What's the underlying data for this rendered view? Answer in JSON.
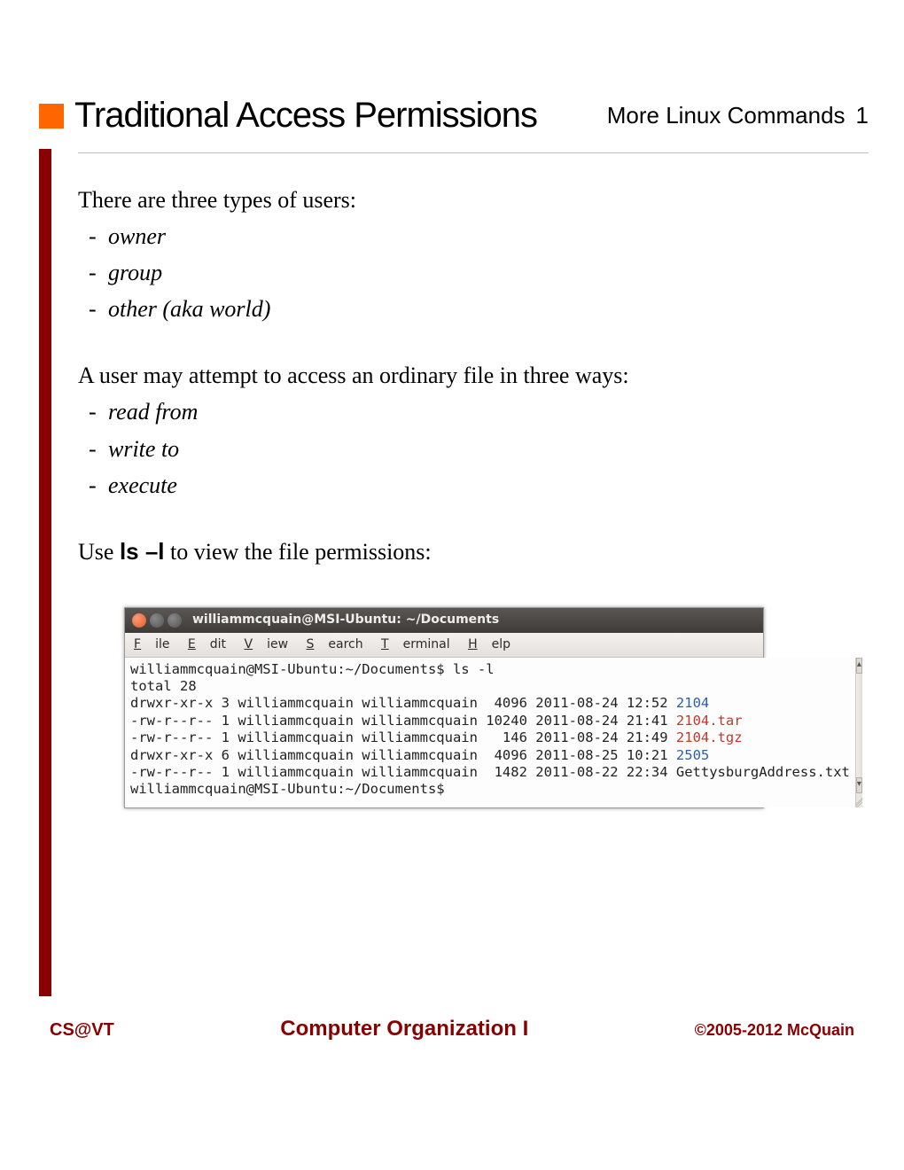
{
  "header": {
    "title": "Traditional Access Permissions",
    "section": "More Linux Commands",
    "page": "1"
  },
  "body": {
    "users_intro": "There are three types of users:",
    "users": [
      "owner",
      "group",
      "other (aka world)"
    ],
    "access_intro": "A user may attempt to access an ordinary file in three ways:",
    "access": [
      "read from",
      "write to",
      "execute"
    ],
    "ls_pre": "Use ",
    "ls_cmd": "ls –l",
    "ls_post": " to view the file permissions:"
  },
  "terminal": {
    "window_title": "williammcquain@MSI-Ubuntu: ~/Documents",
    "menu": {
      "file": "File",
      "edit": "Edit",
      "view": "View",
      "search": "Search",
      "terminal": "Terminal",
      "help": "Help"
    },
    "lines": {
      "prompt_cmd": "williammcquain@MSI-Ubuntu:~/Documents$ ls -l",
      "total": "total 28",
      "r1a": "drwxr-xr-x 3 williammcquain williammcquain  4096 2011-08-24 12:52 ",
      "r1b": "2104",
      "r2a": "-rw-r--r-- 1 williammcquain williammcquain 10240 2011-08-24 21:41 ",
      "r2b": "2104.tar",
      "r3a": "-rw-r--r-- 1 williammcquain williammcquain   146 2011-08-24 21:49 ",
      "r3b": "2104.tgz",
      "r4a": "drwxr-xr-x 6 williammcquain williammcquain  4096 2011-08-25 10:21 ",
      "r4b": "2505",
      "r5": "-rw-r--r-- 1 williammcquain williammcquain  1482 2011-08-22 22:34 GettysburgAddress.txt",
      "prompt_end": "williammcquain@MSI-Ubuntu:~/Documents$"
    }
  },
  "footer": {
    "left": "CS@VT",
    "mid": "Computer Organization I",
    "right": "©2005-2012 McQuain"
  }
}
